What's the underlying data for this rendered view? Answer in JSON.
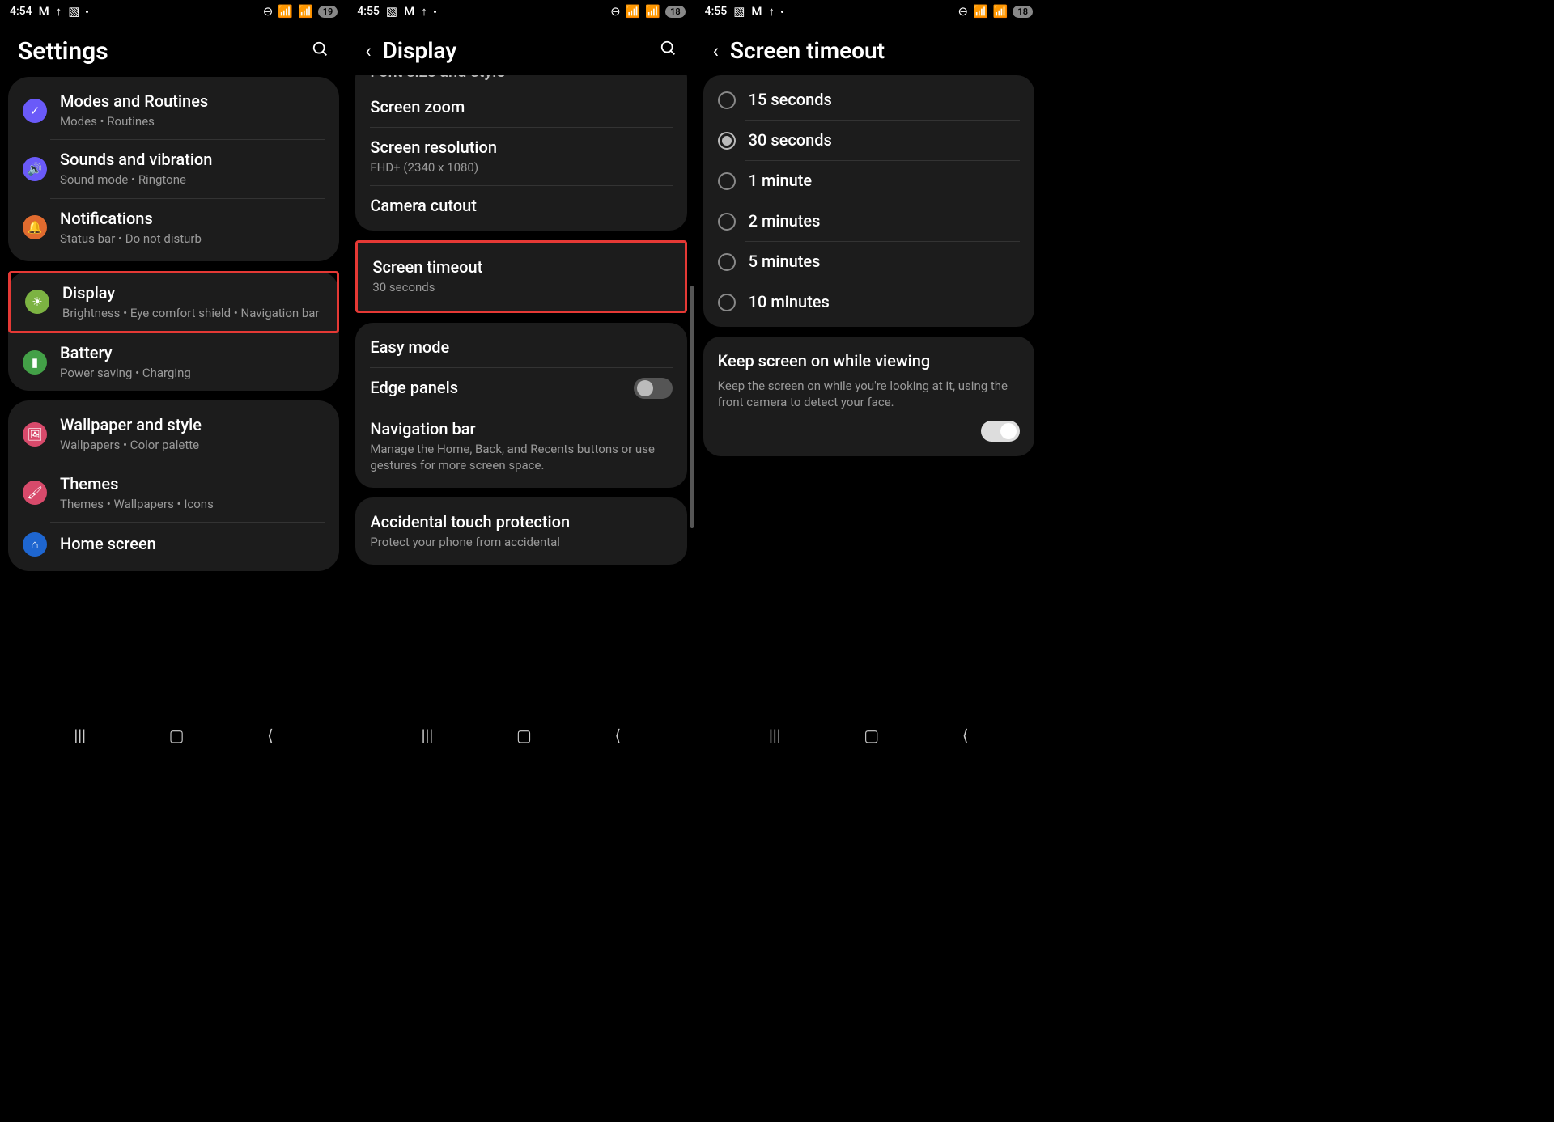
{
  "screen1": {
    "status": {
      "time": "4:54",
      "battery": "19"
    },
    "title": "Settings",
    "groups": [
      {
        "items": [
          {
            "icon_bg": "#6a5af9",
            "icon_glyph": "✓",
            "title": "Modes and Routines",
            "sub": "Modes  •  Routines"
          },
          {
            "icon_bg": "#6a5af9",
            "icon_glyph": "🔊",
            "title": "Sounds and vibration",
            "sub": "Sound mode  •  Ringtone"
          },
          {
            "icon_bg": "#e06b2f",
            "icon_glyph": "🔔",
            "title": "Notifications",
            "sub": "Status bar  •  Do not disturb"
          }
        ]
      },
      {
        "highlight_index": 0,
        "items": [
          {
            "icon_bg": "#7cb342",
            "icon_glyph": "☀",
            "title": "Display",
            "sub": "Brightness  •  Eye comfort shield  •  Navigation bar"
          },
          {
            "icon_bg": "#43a047",
            "icon_glyph": "▮",
            "title": "Battery",
            "sub": "Power saving  •  Charging"
          }
        ]
      },
      {
        "items": [
          {
            "icon_bg": "#d84a6b",
            "icon_glyph": "🖼",
            "title": "Wallpaper and style",
            "sub": "Wallpapers  •  Color palette"
          },
          {
            "icon_bg": "#d84a6b",
            "icon_glyph": "🖌",
            "title": "Themes",
            "sub": "Themes  •  Wallpapers  •  Icons"
          },
          {
            "icon_bg": "#1e66d0",
            "icon_glyph": "⌂",
            "title": "Home screen",
            "sub": ""
          }
        ]
      }
    ]
  },
  "screen2": {
    "status": {
      "time": "4:55",
      "battery": "18"
    },
    "title": "Display",
    "group1": {
      "items": [
        {
          "title": "Font size and style"
        },
        {
          "title": "Screen zoom"
        },
        {
          "title": "Screen resolution",
          "sub": "FHD+ (2340 x 1080)"
        },
        {
          "title": "Camera cutout"
        }
      ]
    },
    "timeout": {
      "title": "Screen timeout",
      "sub": "30 seconds"
    },
    "group3": {
      "items": [
        {
          "title": "Easy mode"
        },
        {
          "title": "Edge panels",
          "toggle": "off"
        },
        {
          "title": "Navigation bar",
          "sub": "Manage the Home, Back, and Recents buttons or use gestures for more screen space."
        }
      ]
    },
    "group4": {
      "title": "Accidental touch protection",
      "sub": "Protect your phone from accidental"
    }
  },
  "screen3": {
    "status": {
      "time": "4:55",
      "battery": "18"
    },
    "title": "Screen timeout",
    "options": [
      {
        "label": "15 seconds",
        "selected": false
      },
      {
        "label": "30 seconds",
        "selected": true
      },
      {
        "label": "1 minute",
        "selected": false
      },
      {
        "label": "2 minutes",
        "selected": false
      },
      {
        "label": "5 minutes",
        "selected": false
      },
      {
        "label": "10 minutes",
        "selected": false
      }
    ],
    "keep_on": {
      "title": "Keep screen on while viewing",
      "desc": "Keep the screen on while you're looking at it, using the front camera to detect your face.",
      "toggle": "on"
    }
  },
  "status_icons": {
    "gm": "M",
    "up": "↑",
    "img": "▧",
    "dnd": "⊖",
    "wifi": "⧋",
    "sig": "▮"
  }
}
